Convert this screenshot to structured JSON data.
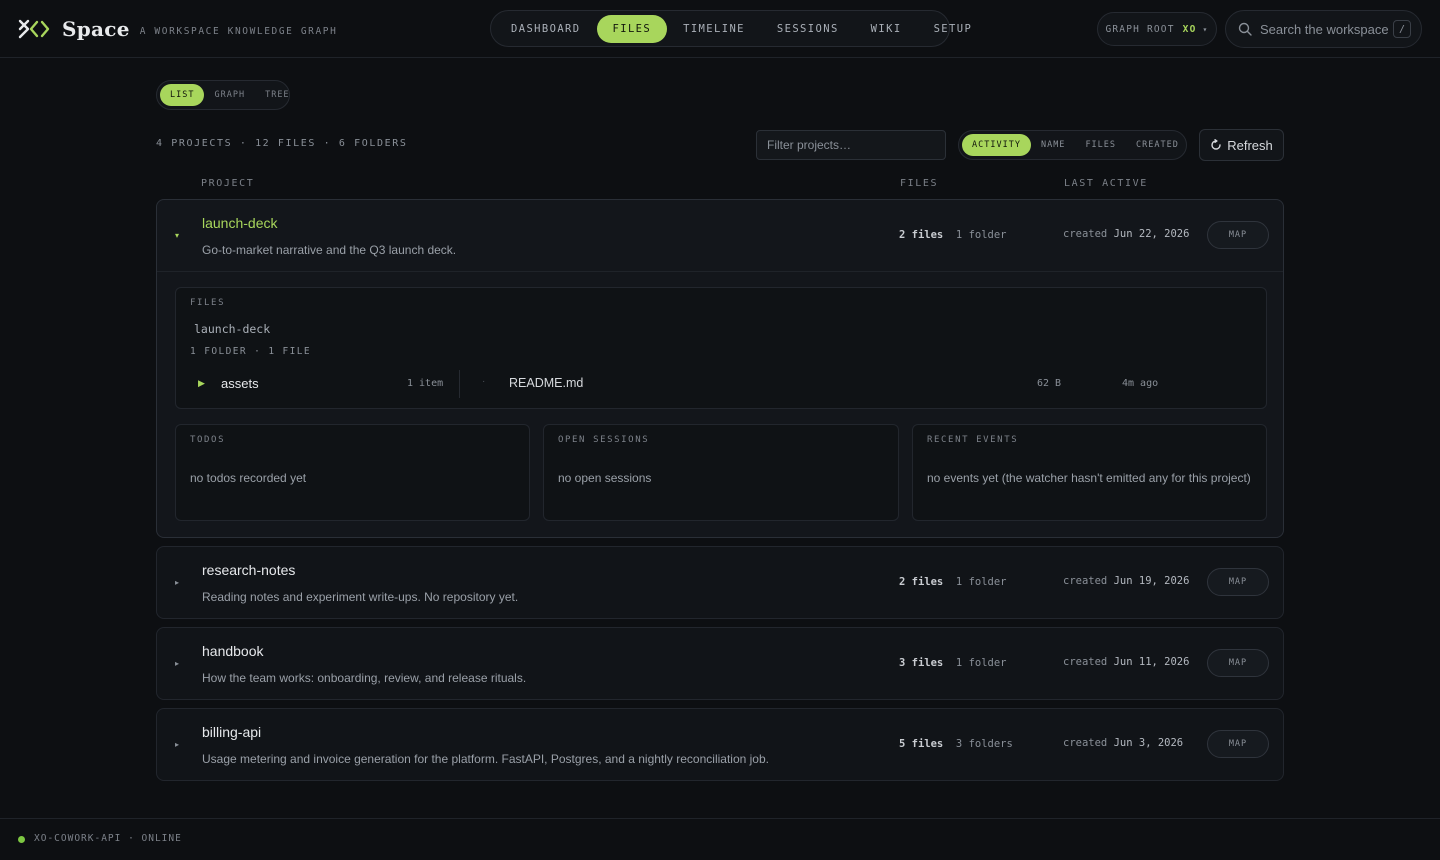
{
  "brand": {
    "name": "Space",
    "tagline": "A WORKSPACE KNOWLEDGE GRAPH",
    "accent": "#a8d65c"
  },
  "nav": {
    "tabs": [
      "DASHBOARD",
      "FILES",
      "TIMELINE",
      "SESSIONS",
      "WIKI",
      "SETUP"
    ],
    "active": "FILES"
  },
  "graph_root": {
    "label": "GRAPH ROOT",
    "value": "XO"
  },
  "search": {
    "placeholder": "Search the workspace…",
    "shortcut": "/"
  },
  "view_toggle": {
    "options": [
      "LIST",
      "GRAPH",
      "TREE"
    ],
    "active": "LIST"
  },
  "summary": "4 PROJECTS · 12 FILES · 6 FOLDERS",
  "filter": {
    "placeholder": "Filter projects…"
  },
  "sort": {
    "options": [
      "ACTIVITY",
      "NAME",
      "FILES",
      "CREATED"
    ],
    "active": "ACTIVITY"
  },
  "refresh_label": "Refresh",
  "columns": {
    "project": "PROJECT",
    "files": "FILES",
    "last_active": "LAST ACTIVE"
  },
  "projects": [
    {
      "name": "launch-deck",
      "description": "Go-to-market narrative and the Q3 launch deck.",
      "files_count": "2 files",
      "folders_count": "1 folder",
      "created_label": "created",
      "created_date": "Jun 22, 2026",
      "map_label": "MAP",
      "expanded": true,
      "files_panel": {
        "title": "FILES",
        "path": "launch-deck",
        "counts": "1 FOLDER · 1 FILE",
        "folder": {
          "name": "assets",
          "items": "1 item"
        },
        "file": {
          "name": "README.md",
          "size": "62 B",
          "modified": "4m ago"
        }
      },
      "todos": {
        "title": "TODOS",
        "empty": "no todos recorded yet"
      },
      "sessions": {
        "title": "OPEN SESSIONS",
        "empty": "no open sessions"
      },
      "events": {
        "title": "RECENT EVENTS",
        "empty": "no events yet (the watcher hasn't emitted any for this project)"
      }
    },
    {
      "name": "research-notes",
      "description": "Reading notes and experiment write-ups. No repository yet.",
      "files_count": "2 files",
      "folders_count": "1 folder",
      "created_label": "created",
      "created_date": "Jun 19, 2026",
      "map_label": "MAP",
      "expanded": false
    },
    {
      "name": "handbook",
      "description": "How the team works: onboarding, review, and release rituals.",
      "files_count": "3 files",
      "folders_count": "1 folder",
      "created_label": "created",
      "created_date": "Jun 11, 2026",
      "map_label": "MAP",
      "expanded": false
    },
    {
      "name": "billing-api",
      "description": "Usage metering and invoice generation for the platform. FastAPI, Postgres, and a nightly reconciliation job.",
      "files_count": "5 files",
      "folders_count": "3 folders",
      "created_label": "created",
      "created_date": "Jun 3, 2026",
      "map_label": "MAP",
      "expanded": false
    }
  ],
  "footer": {
    "status": "XO-COWORK-API · ONLINE",
    "status_color": "#7dc742"
  }
}
